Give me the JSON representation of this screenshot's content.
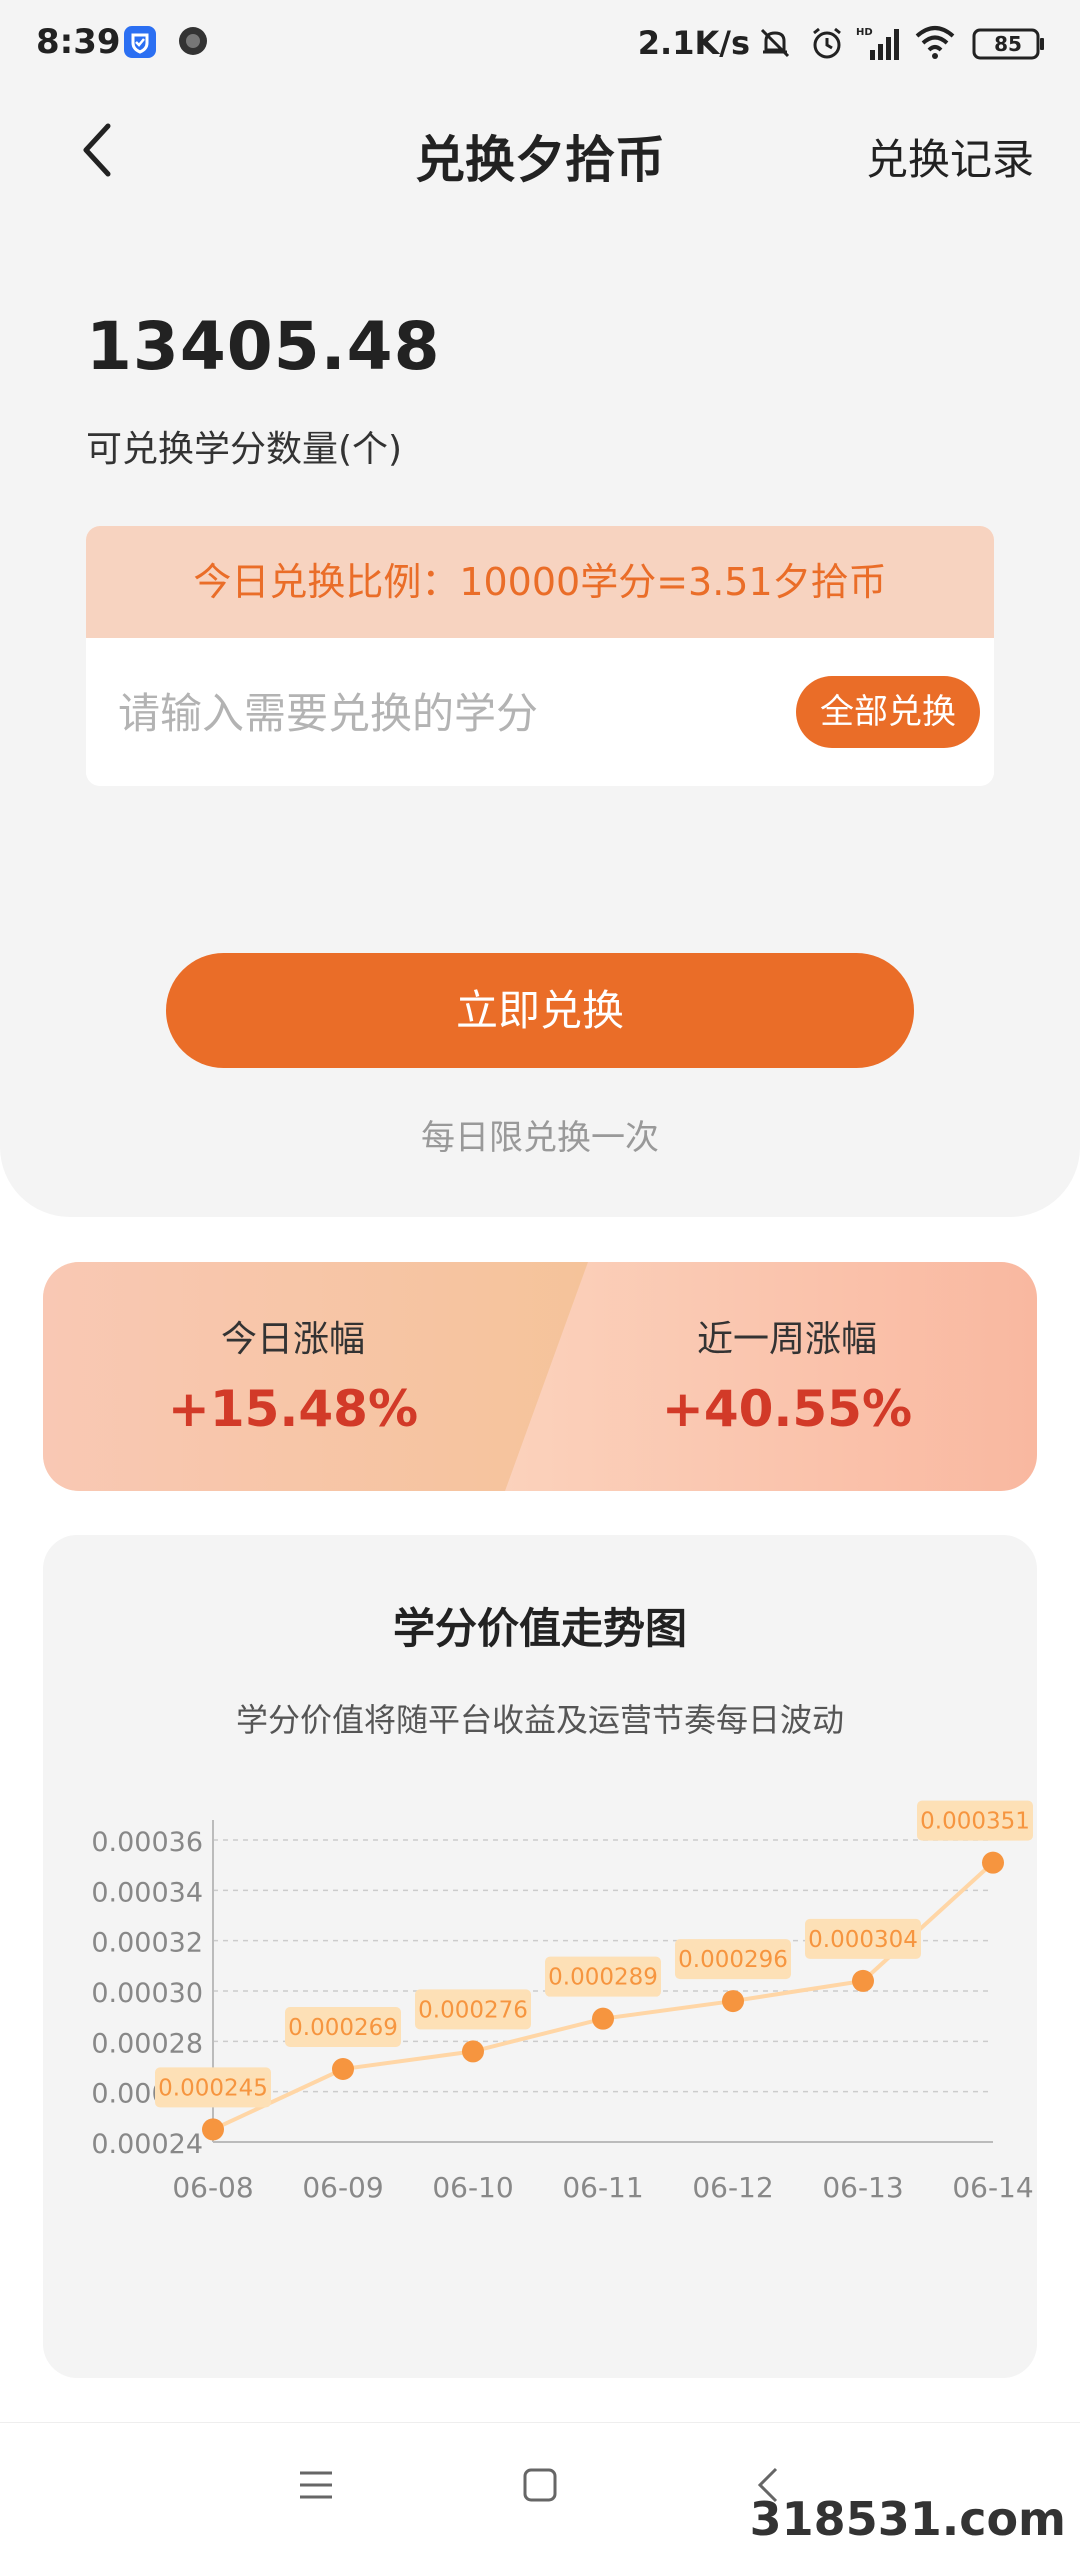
{
  "status_bar": {
    "time": "8:39",
    "net_speed": "2.1K/s",
    "battery": "85",
    "icons": [
      "shield-app-icon",
      "circle-app-icon",
      "mute-bell-icon",
      "alarm-icon",
      "hd-signal-icon",
      "wifi-icon",
      "battery-icon"
    ]
  },
  "header": {
    "title": "兑换夕拾币",
    "record_label": "兑换记录",
    "back_icon": "chevron-left-icon"
  },
  "balance": {
    "value": "13405.48",
    "label": "可兑换学分数量(个)"
  },
  "exchange": {
    "rate_text": "今日兑换比例：10000学分=3.51夕拾币",
    "input_placeholder": "请输入需要兑换的学分",
    "all_button": "全部兑换",
    "submit_button": "立即兑换",
    "limit_note": "每日限兑换一次"
  },
  "rise": {
    "today_label": "今日涨幅",
    "today_value": "+15.48%",
    "week_label": "近一周涨幅",
    "week_value": "+40.55%"
  },
  "chart_title": "学分价值走势图",
  "chart_subtitle": "学分价值将随平台收益及运营节奏每日波动",
  "chart_data": {
    "type": "line",
    "x": [
      "06-08",
      "06-09",
      "06-10",
      "06-11",
      "06-12",
      "06-13",
      "06-14"
    ],
    "values": [
      0.000245,
      0.000269,
      0.000276,
      0.000289,
      0.000296,
      0.000304,
      0.000351
    ],
    "data_labels": [
      "0.000245",
      "0.000269",
      "0.000276",
      "0.000289",
      "0.000296",
      "0.000304",
      "0.000351"
    ],
    "y_ticks": [
      "0.00024",
      "0.00026",
      "0.00028",
      "0.00030",
      "0.00032",
      "0.00034",
      "0.00036"
    ],
    "ylim": [
      0.00024,
      0.00036
    ],
    "grid": true,
    "line_color": "#ffd6a6",
    "point_color": "#f6953f",
    "label_bg": "#fde0b6",
    "label_color": "#f6953f"
  },
  "navbar": {
    "menu_icon": "menu-icon",
    "home_icon": "home-square-icon",
    "back_icon": "back-chevron-icon"
  },
  "watermark": "318531.com",
  "colors": {
    "accent": "#ea6d28",
    "rise_red": "#d23a28",
    "card_bg": "#f4f4f4"
  }
}
